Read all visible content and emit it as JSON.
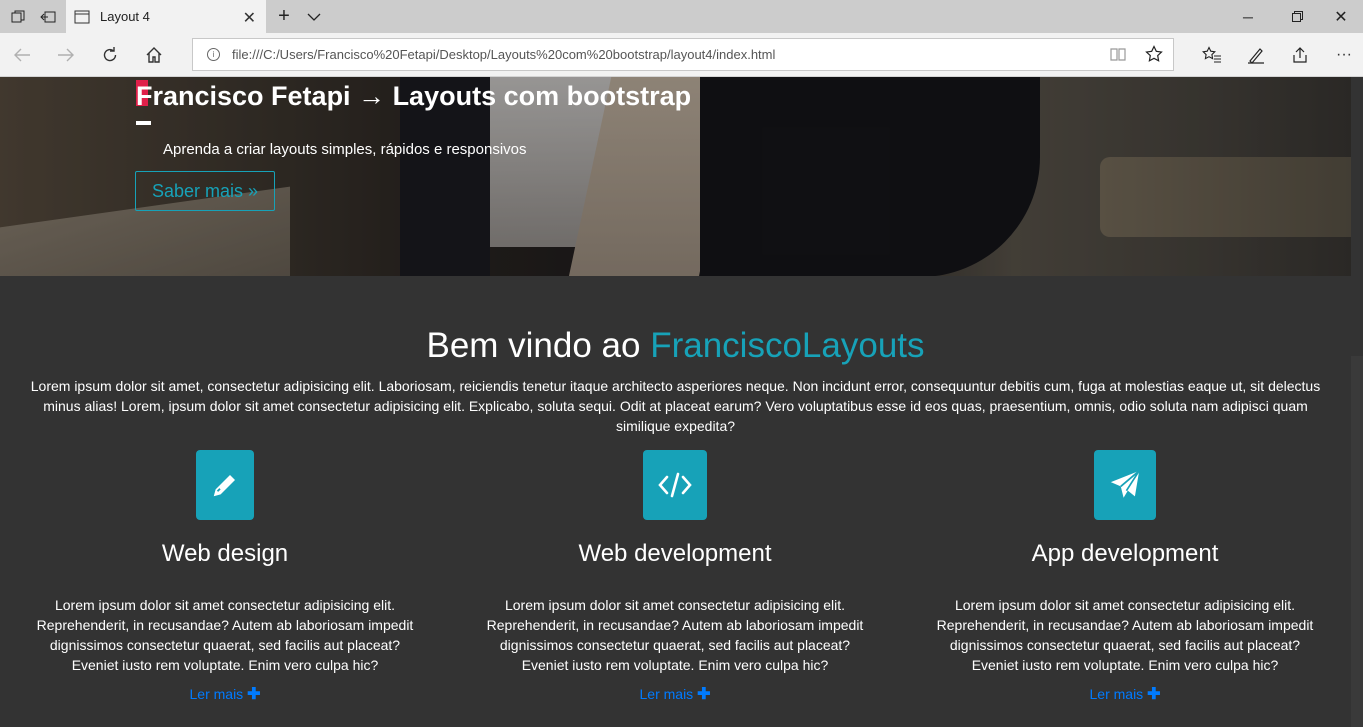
{
  "browser": {
    "tab_title": "Layout 4",
    "url": "file:///C:/Users/Francisco%20Fetapi/Desktop/Layouts%20com%20bootstrap/layout4/index.html"
  },
  "hero": {
    "title": "Francisco Fetapi → Layouts com bootstrap",
    "subtitle": "Aprenda a criar layouts simples, rápidos e responsivos",
    "button": "Saber mais »"
  },
  "welcome": {
    "title_prefix": "Bem vindo ao ",
    "title_accent": "FranciscoLayouts",
    "text": "Lorem ipsum dolor sit amet, consectetur adipisicing elit. Laboriosam, reiciendis tenetur itaque architecto asperiores neque. Non incidunt error, consequuntur debitis cum, fuga at molestias eaque ut, sit delectus minus alias! Lorem, ipsum dolor sit amet consectetur adipisicing elit. Explicabo, soluta sequi. Odit at placeat earum? Vero voluptatibus esse id eos quas, praesentium, omnis, odio soluta nam adipisci quam similique expedita?"
  },
  "features": [
    {
      "icon": "pencil-icon",
      "title": "Web design",
      "text": "Lorem ipsum dolor sit amet consectetur adipisicing elit. Reprehenderit, in recusandae? Autem ab laboriosam impedit dignissimos consectetur quaerat, sed facilis aut placeat? Eveniet iusto rem voluptate. Enim vero culpa hic?",
      "link": "Ler mais"
    },
    {
      "icon": "code-icon",
      "title": "Web development",
      "text": "Lorem ipsum dolor sit amet consectetur adipisicing elit. Reprehenderit, in recusandae? Autem ab laboriosam impedit dignissimos consectetur quaerat, sed facilis aut placeat? Eveniet iusto rem voluptate. Enim vero culpa hic?",
      "link": "Ler mais"
    },
    {
      "icon": "paper-plane-icon",
      "title": "App development",
      "text": "Lorem ipsum dolor sit amet consectetur adipisicing elit. Reprehenderit, in recusandae? Autem ab laboriosam impedit dignissimos consectetur quaerat, sed facilis aut placeat? Eveniet iusto rem voluptate. Enim vero culpa hic?",
      "link": "Ler mais"
    }
  ],
  "colors": {
    "accent": "#17a2b8",
    "link": "#007bff",
    "background": "#333333",
    "hero_mark": "#e0204a"
  }
}
